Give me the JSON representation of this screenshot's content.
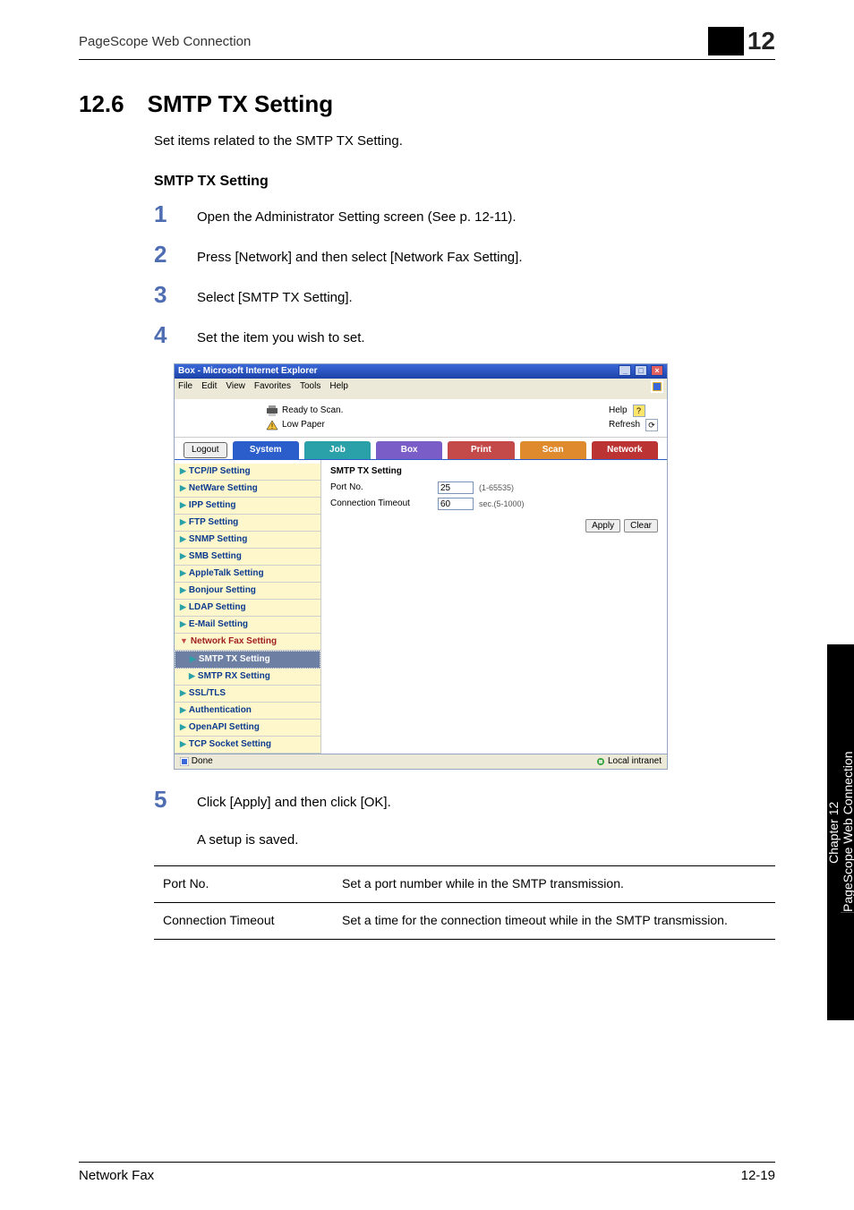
{
  "runningHead": "PageScope Web Connection",
  "chapterBigNum": "12",
  "section": {
    "num": "12.6",
    "title": "SMTP TX Setting",
    "intro": "Set items related to the SMTP TX Setting.",
    "subheading": "SMTP TX Setting"
  },
  "steps": [
    "Open the Administrator Setting screen (See p. 12-11).",
    "Press [Network] and then select [Network Fax Setting].",
    "Select [SMTP TX Setting].",
    "Set the item you wish to set."
  ],
  "afterShotStep": "Click [Apply] and then click [OK].",
  "afterShotNote": "A setup is saved.",
  "shot": {
    "windowTitle": "Box - Microsoft Internet Explorer",
    "menubar": [
      "File",
      "Edit",
      "View",
      "Favorites",
      "Tools",
      "Help"
    ],
    "statusReady": "Ready to Scan.",
    "statusLowPaper": "Low Paper",
    "help": "Help",
    "refresh": "Refresh",
    "logout": "Logout",
    "tabs": {
      "system": "System",
      "job": "Job",
      "box": "Box",
      "print": "Print",
      "scan": "Scan",
      "network": "Network"
    },
    "sidebar": [
      {
        "label": "TCP/IP Setting",
        "marker": "tri"
      },
      {
        "label": "NetWare Setting",
        "marker": "tri"
      },
      {
        "label": "IPP Setting",
        "marker": "tri"
      },
      {
        "label": "FTP Setting",
        "marker": "tri"
      },
      {
        "label": "SNMP Setting",
        "marker": "tri"
      },
      {
        "label": "SMB Setting",
        "marker": "tri"
      },
      {
        "label": "AppleTalk Setting",
        "marker": "tri"
      },
      {
        "label": "Bonjour Setting",
        "marker": "tri"
      },
      {
        "label": "LDAP Setting",
        "marker": "tri"
      },
      {
        "label": "E-Mail Setting",
        "marker": "tri"
      },
      {
        "label": "Network Fax Setting",
        "marker": "tridown",
        "cls": "parent-open"
      },
      {
        "label": "SMTP TX Setting",
        "marker": "tri",
        "cls": "child active"
      },
      {
        "label": "SMTP RX Setting",
        "marker": "tri",
        "cls": "child"
      },
      {
        "label": "SSL/TLS",
        "marker": "tri"
      },
      {
        "label": "Authentication",
        "marker": "tri"
      },
      {
        "label": "OpenAPI Setting",
        "marker": "tri"
      },
      {
        "label": "TCP Socket Setting",
        "marker": "tri"
      }
    ],
    "panel": {
      "title": "SMTP TX Setting",
      "portLabel": "Port No.",
      "portValue": "25",
      "portHint": "(1-65535)",
      "connLabel": "Connection Timeout",
      "connValue": "60",
      "connHint": "sec.(5-1000)",
      "apply": "Apply",
      "clear": "Clear"
    },
    "statusbar": {
      "done": "Done",
      "zone": "Local intranet"
    }
  },
  "table": [
    {
      "key": "Port No.",
      "val": "Set a port number while in the SMTP transmission."
    },
    {
      "key": "Connection Timeout",
      "val": "Set a time for the connection timeout while in the SMTP transmission."
    }
  ],
  "sideTab": {
    "top": "Chapter 12",
    "bottom": "PageScope Web Connection"
  },
  "footer": {
    "left": "Network Fax",
    "right": "12-19"
  }
}
